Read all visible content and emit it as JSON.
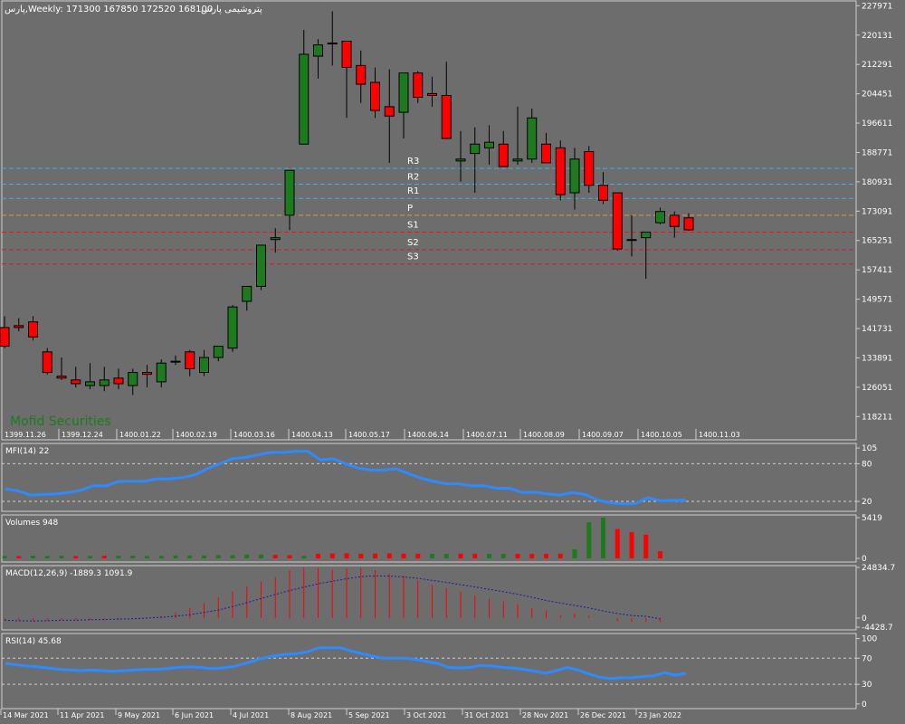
{
  "header": {
    "symbol_text": "پارس,Weekly:  171300 167850 172520 168100",
    "title_fa": "پتروشیمی پارس"
  },
  "watermark": "Mofid Securities",
  "colors": {
    "background": "#6d6d6d",
    "bull": "#1e7a1e",
    "bear": "#ff0000",
    "grid": "#cfcfcf",
    "resistance": "#2fb8e0",
    "pivot": "#e0a020",
    "support": "#e01b1b",
    "indicator_line": "#2d8bff",
    "macd_signal": "#1a1aa0"
  },
  "chart_data": [
    {
      "type": "candlestick",
      "title": "پتروشیمی پارس",
      "period": "Weekly",
      "ohlc_last": {
        "open": 171300,
        "high": 172520,
        "low": 167850,
        "close": 168100
      },
      "y_ticks": [
        227971,
        220131,
        212291,
        204451,
        196611,
        188771,
        180931,
        173091,
        165251,
        157411,
        149571,
        141731,
        133891,
        126051,
        118211
      ],
      "y_range": [
        112000,
        229500
      ],
      "x_labels_top": [
        "1399.11.26",
        "1399.12.24",
        "1400.01.22",
        "1400.02.19",
        "1400.03.16",
        "1400.04.13",
        "1400.05.17",
        "1400.06.14",
        "1400.07.11",
        "1400.08.09",
        "1400.09.07",
        "1400.10.05",
        "1400.11.03"
      ],
      "candles": [
        [
          142000,
          145000,
          136500,
          137000
        ],
        [
          142500,
          144500,
          141000,
          142000
        ],
        [
          143500,
          145000,
          138500,
          139500
        ],
        [
          135500,
          136500,
          129500,
          130000
        ],
        [
          129000,
          134000,
          128000,
          128500
        ],
        [
          128000,
          131500,
          126000,
          127000
        ],
        [
          126500,
          132500,
          125500,
          127500
        ],
        [
          126500,
          131500,
          125000,
          128000
        ],
        [
          128500,
          131000,
          125500,
          127000
        ],
        [
          126500,
          131000,
          124000,
          130000
        ],
        [
          130000,
          132000,
          126000,
          129500
        ],
        [
          127500,
          133500,
          126000,
          132500
        ],
        [
          133000,
          134500,
          132000,
          133000
        ],
        [
          135500,
          136000,
          129000,
          131000
        ],
        [
          130000,
          136000,
          129000,
          134000
        ],
        [
          134000,
          137000,
          133000,
          137000
        ],
        [
          136500,
          148000,
          135500,
          147500
        ],
        [
          149000,
          152500,
          146500,
          153000
        ],
        [
          153000,
          162500,
          152000,
          164000
        ],
        [
          165500,
          168500,
          162000,
          166000
        ],
        [
          172000,
          181000,
          168000,
          184000
        ],
        [
          191000,
          221500,
          191000,
          215000
        ],
        [
          214500,
          219000,
          208500,
          217500
        ],
        [
          218000,
          226500,
          212000,
          218000
        ],
        [
          218500,
          218500,
          198000,
          211500
        ],
        [
          212000,
          216000,
          202000,
          207000
        ],
        [
          207500,
          211500,
          198000,
          200000
        ],
        [
          201000,
          211000,
          186000,
          198500
        ],
        [
          199500,
          210000,
          192500,
          210000
        ],
        [
          210000,
          210500,
          202000,
          203500
        ],
        [
          204500,
          209000,
          201000,
          204000
        ],
        [
          204000,
          213000,
          192500,
          192500
        ],
        [
          186500,
          194500,
          181000,
          187000
        ],
        [
          188500,
          195500,
          178000,
          191000
        ],
        [
          190000,
          196000,
          185500,
          191500
        ],
        [
          191000,
          194500,
          186000,
          185000
        ],
        [
          186500,
          201000,
          185500,
          187000
        ],
        [
          187000,
          200500,
          186000,
          198000
        ],
        [
          191000,
          194000,
          186000,
          186000
        ],
        [
          190000,
          192000,
          176000,
          177500
        ],
        [
          178000,
          190000,
          173500,
          187000
        ],
        [
          189000,
          190500,
          178000,
          180000
        ],
        [
          180000,
          183500,
          175000,
          176000
        ],
        [
          178000,
          178000,
          162500,
          163000
        ],
        [
          165500,
          172000,
          161000,
          165500
        ],
        [
          166000,
          167500,
          155000,
          167500
        ],
        [
          170000,
          174000,
          169500,
          173000
        ],
        [
          172000,
          173000,
          166000,
          169000
        ],
        [
          171300,
          172520,
          167850,
          168100
        ]
      ],
      "levels": [
        {
          "name": "R3",
          "value": 184500,
          "kind": "resistance"
        },
        {
          "name": "R2",
          "value": 180300,
          "kind": "resistance"
        },
        {
          "name": "R1",
          "value": 176500,
          "kind": "resistance"
        },
        {
          "name": "P",
          "value": 172000,
          "kind": "pivot"
        },
        {
          "name": "S1",
          "value": 167500,
          "kind": "support"
        },
        {
          "name": "S2",
          "value": 162800,
          "kind": "support"
        },
        {
          "name": "S3",
          "value": 159000,
          "kind": "support"
        }
      ]
    },
    {
      "type": "line",
      "title": "MFI(14) 22",
      "y_ticks": [
        105,
        80,
        20
      ],
      "y_range": [
        10,
        108
      ],
      "levels": [
        80,
        20
      ],
      "values": [
        40,
        37,
        30,
        31,
        32,
        34,
        38,
        45,
        45,
        52,
        52,
        52,
        56,
        56,
        58,
        62,
        72,
        80,
        88,
        90,
        94,
        98,
        98,
        100,
        100,
        86,
        88,
        80,
        73,
        70,
        70,
        72,
        64,
        57,
        52,
        48,
        48,
        45,
        45,
        41,
        41,
        34,
        35,
        32,
        30,
        34,
        31,
        22,
        18,
        16,
        17,
        26,
        21,
        22,
        22
      ]
    },
    {
      "type": "bar",
      "title": "Volumes 948",
      "y_ticks": [
        5419,
        0
      ],
      "y_range": [
        0,
        5419
      ],
      "values": [
        330,
        300,
        360,
        320,
        350,
        320,
        330,
        370,
        350,
        360,
        320,
        330,
        380,
        380,
        400,
        420,
        430,
        520,
        520,
        470,
        420,
        330,
        620,
        650,
        680,
        630,
        650,
        660,
        620,
        620,
        600,
        600,
        620,
        620,
        590,
        600,
        600,
        590,
        610,
        620,
        1200,
        4800,
        5419,
        3900,
        3500,
        3150,
        948
      ],
      "bull": [
        true,
        false,
        true,
        true,
        true,
        false,
        true,
        false,
        true,
        true,
        true,
        true,
        true,
        true,
        true,
        true,
        true,
        true,
        true,
        false,
        false,
        true,
        false,
        false,
        false,
        false,
        false,
        false,
        false,
        false,
        true,
        true,
        false,
        false,
        true,
        true,
        false,
        false,
        false,
        false,
        true,
        true,
        true,
        false,
        false,
        false,
        false
      ]
    },
    {
      "type": "bar+line",
      "title": "MACD(12,26,9) -1889.3 1091.9",
      "y_ticks": [
        24834.7,
        0,
        -4428.7
      ],
      "y_range": [
        -4428.7,
        24834.7
      ],
      "histogram": [
        -800,
        -1100,
        -1300,
        -1200,
        -1000,
        -1100,
        -900,
        -800,
        -500,
        -200,
        300,
        1000,
        2800,
        5000,
        7500,
        10000,
        13000,
        15600,
        18000,
        20000,
        23200,
        24800,
        24600,
        24000,
        24500,
        24600,
        23500,
        21700,
        20800,
        18500,
        16300,
        14700,
        13000,
        11000,
        9500,
        8200,
        6800,
        5000,
        3800,
        1500,
        2200,
        1200,
        -200,
        -1500,
        -1900,
        -1700,
        -1900
      ],
      "signal": [
        -1000,
        -1300,
        -1400,
        -1300,
        -1000,
        -1000,
        -800,
        -700,
        -500,
        -300,
        0,
        400,
        1000,
        1700,
        2800,
        4000,
        5700,
        7600,
        9600,
        11600,
        13500,
        15200,
        16800,
        18100,
        19300,
        20300,
        20700,
        20600,
        20200,
        19500,
        18500,
        17500,
        16400,
        15300,
        14100,
        13000,
        11700,
        10200,
        8600,
        7400,
        6200,
        5000,
        3500,
        2200,
        1300,
        900,
        -400
      ]
    },
    {
      "type": "line",
      "title": "RSI(14) 45.68",
      "y_ticks": [
        100.0,
        70.0,
        30.0,
        0.0
      ],
      "y_range": [
        -3,
        105
      ],
      "levels": [
        70,
        30
      ],
      "values": [
        62,
        60,
        58,
        57,
        55,
        53,
        52,
        51,
        52,
        51,
        50,
        51,
        52,
        53,
        53,
        54,
        56,
        57,
        56,
        54,
        55,
        57,
        61,
        66,
        71,
        74,
        76,
        77,
        80,
        86,
        86,
        86,
        81,
        77,
        73,
        70,
        70,
        70,
        68,
        65,
        62,
        56,
        55,
        56,
        59,
        58,
        56,
        55,
        53,
        50,
        47,
        51,
        56,
        52,
        46,
        41,
        39,
        40,
        40,
        42,
        43,
        48,
        44,
        47
      ]
    }
  ],
  "x_labels_bottom": [
    "14 Mar 2021",
    "11 Apr 2021",
    "9 May 2021",
    "6 Jun 2021",
    "4 Jul 2021",
    "8 Aug 2021",
    "5 Sep 2021",
    "3 Oct 2021",
    "31 Oct 2021",
    "28 Nov 2021",
    "26 Dec 2021",
    "23 Jan 2022"
  ]
}
